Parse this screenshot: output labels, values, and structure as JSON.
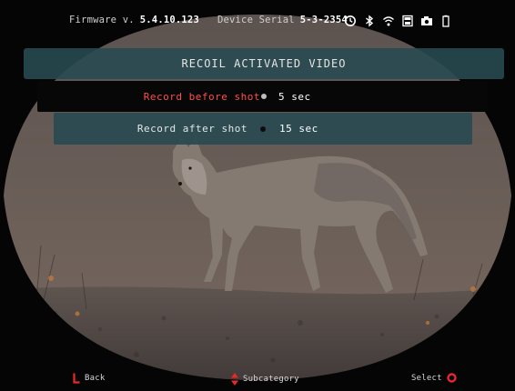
{
  "status_bar": {
    "firmware_label": "Firmware v.",
    "firmware_version": "5.4.10.123",
    "serial_label": "Device Serial",
    "serial_number": "5-3-2354",
    "icons": [
      "recoil-timer-icon",
      "bluetooth-icon",
      "wifi-icon",
      "sd-card-icon",
      "camera-icon",
      "battery-icon"
    ]
  },
  "menu": {
    "title": "RECOIL ACTIVATED VIDEO",
    "items": [
      {
        "label": "Record before shot",
        "value": "5 sec",
        "selected": true
      },
      {
        "label": "Record after shot",
        "value": "15 sec",
        "selected": false
      }
    ]
  },
  "footer": {
    "back_label": "Back",
    "subcategory_label": "Subcategory",
    "select_label": "Select"
  },
  "colors": {
    "selected_text": "#ff4d4d",
    "banner": "#284a50",
    "accent_red": "#e8282b"
  }
}
